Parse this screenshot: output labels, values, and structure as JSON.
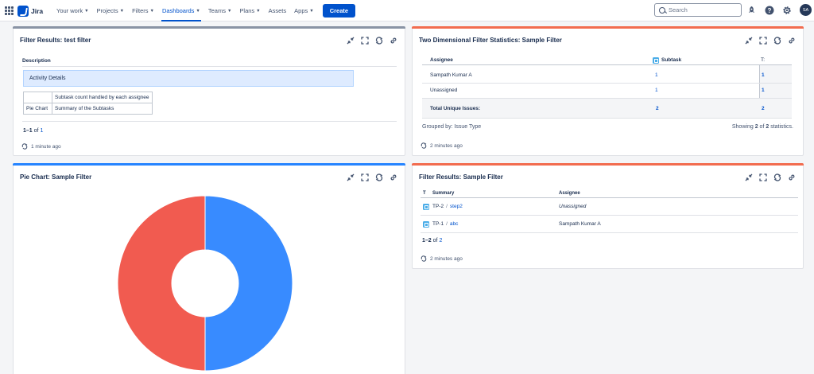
{
  "nav": {
    "logo_text": "Jira",
    "items": [
      {
        "label": "Your work",
        "chevron": true
      },
      {
        "label": "Projects",
        "chevron": true
      },
      {
        "label": "Filters",
        "chevron": true
      },
      {
        "label": "Dashboards",
        "chevron": true,
        "active": true
      },
      {
        "label": "Teams",
        "chevron": true
      },
      {
        "label": "Plans",
        "chevron": true
      },
      {
        "label": "Assets",
        "chevron": false
      },
      {
        "label": "Apps",
        "chevron": true
      }
    ],
    "create_label": "Create",
    "search_placeholder": "Search",
    "avatar_initials": "SA",
    "icons": [
      "notifications-rocket-icon",
      "help-icon",
      "settings-gear-icon"
    ]
  },
  "gadget_tools": [
    "minimize-icon",
    "maximize-icon",
    "refresh-icon",
    "link-icon"
  ],
  "gadgets": {
    "filter_test": {
      "title": "Filter Results: test filter",
      "accent": "#8993a4",
      "column_header": "Description",
      "activity_heading": "Activity Details",
      "rows": [
        {
          "label": "",
          "value": "Subtask count handled by each assignee"
        },
        {
          "label": "Pie Chart",
          "value": "Summary of the Subtasks"
        }
      ],
      "count_range": "1–1",
      "count_of": "of",
      "count_total": "1",
      "updated": "1 minute ago"
    },
    "two_dim": {
      "title": "Two Dimensional Filter Statistics: Sample Filter",
      "accent": "#f26c4f",
      "headers": {
        "assignee": "Assignee",
        "subtask": "Subtask",
        "total": "T:"
      },
      "rows": [
        {
          "assignee": "Sampath Kumar A",
          "subtask": "1",
          "total": "1"
        },
        {
          "assignee": "Unassigned",
          "subtask": "1",
          "total": "1"
        }
      ],
      "total_row": {
        "label": "Total Unique Issues:",
        "subtask": "2",
        "total": "2"
      },
      "grouped_by": "Grouped by: Issue Type",
      "showing_prefix": "Showing",
      "showing_count": "2",
      "showing_of": "of",
      "showing_total": "2",
      "showing_suffix": "statistics.",
      "updated": "2 minutes ago"
    },
    "pie": {
      "title": "Pie Chart: Sample Filter",
      "accent": "#2684ff"
    },
    "filter_sample": {
      "title": "Filter Results: Sample Filter",
      "accent": "#f26c4f",
      "headers": {
        "type": "T",
        "summary": "Summary",
        "assignee": "Assignee"
      },
      "rows": [
        {
          "key": "TP-2",
          "summary": "step2",
          "assignee": "Unassigned",
          "italic": true
        },
        {
          "key": "TP-1",
          "summary": "abc",
          "assignee": "Sampath Kumar A",
          "italic": false
        }
      ],
      "separator": "/",
      "count_range": "1–2",
      "count_of": "of",
      "count_total": "2",
      "updated": "2 minutes ago"
    }
  },
  "chart_data": {
    "type": "pie",
    "title": "",
    "donut": true,
    "slices": [
      {
        "value": 1,
        "color": "#388bff"
      },
      {
        "value": 1,
        "color": "#f15b50"
      }
    ]
  }
}
